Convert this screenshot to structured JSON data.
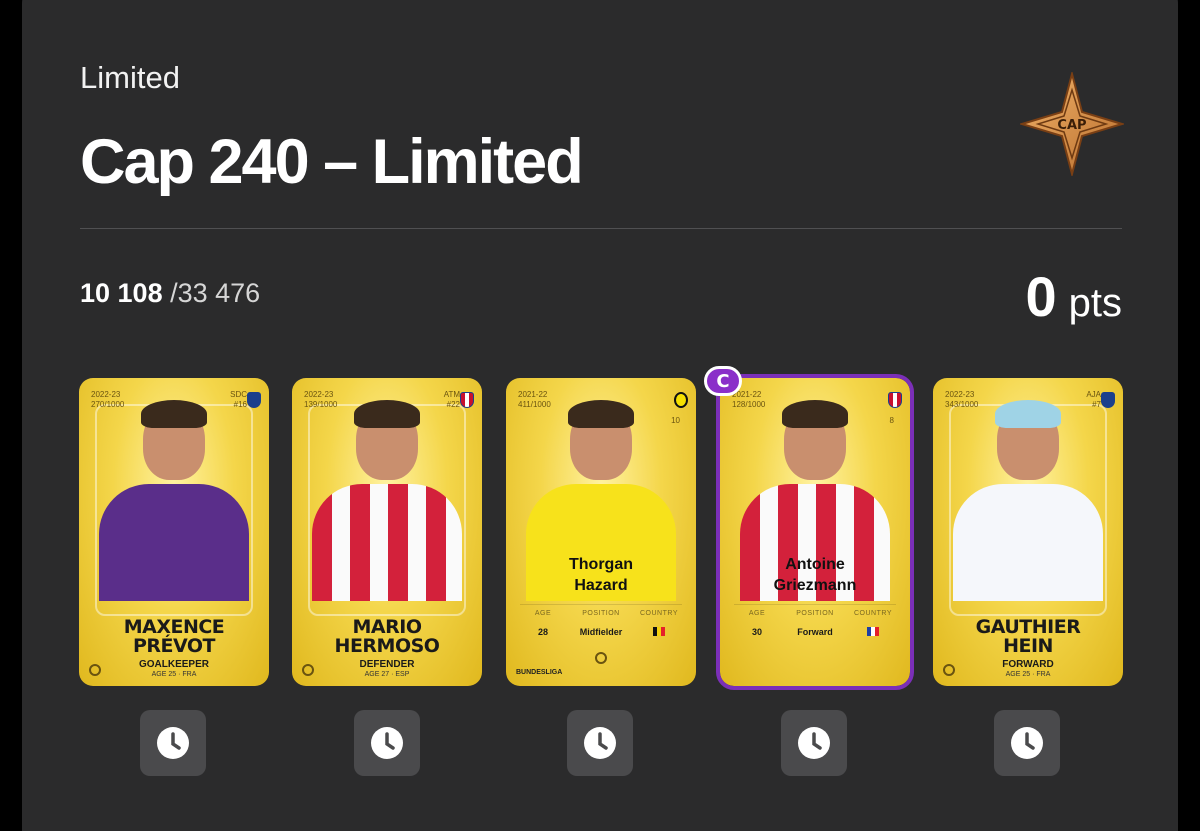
{
  "header": {
    "league_label": "Limited",
    "competition_title": "Cap 240 – Limited",
    "badge_text": "CAP"
  },
  "ranking": {
    "position": "10 108",
    "total": "/33 476"
  },
  "score": {
    "value": "0",
    "unit": "pts"
  },
  "cards": [
    {
      "season": "2022-23",
      "serial": "270/1000",
      "club_code": "SDC",
      "shirt_number": "#16",
      "name_line1": "MAXENCE",
      "name_line2": "PRÉVOT",
      "position": "GOALKEEPER",
      "age_country": "AGE 25 · FRA",
      "kit": "purple",
      "captain": false
    },
    {
      "season": "2022-23",
      "serial": "139/1000",
      "club_code": "ATM",
      "shirt_number": "#22",
      "name_line1": "MARIO",
      "name_line2": "HERMOSO",
      "position": "DEFENDER",
      "age_country": "AGE 27 · ESP",
      "kit": "atm",
      "captain": false
    },
    {
      "season": "2021-22",
      "serial": "411/1000",
      "number": "10",
      "name_line1": "Thorgan",
      "name_line2": "Hazard",
      "stat_labels": [
        "AGE",
        "POSITION",
        "COUNTRY"
      ],
      "age": "28",
      "position": "Midfielder",
      "league": "BUNDESLIGA",
      "kit": "bvb",
      "captain": false
    },
    {
      "season": "2021-22",
      "serial": "128/1000",
      "number": "8",
      "name_line1": "Antoine",
      "name_line2": "Griezmann",
      "stat_labels": [
        "AGE",
        "POSITION",
        "COUNTRY"
      ],
      "age": "30",
      "position": "Forward",
      "kit": "atm",
      "captain": true
    },
    {
      "season": "2022-23",
      "serial": "343/1000",
      "club_code": "AJA",
      "shirt_number": "#7",
      "name_line1": "GAUTHIER",
      "name_line2": "HEIN",
      "position": "FORWARD",
      "age_country": "AGE 25 · FRA",
      "kit": "aja",
      "captain": false
    }
  ],
  "captain_badge": "C",
  "colors": {
    "panel": "#2b2b2c",
    "card_gold": "#f4d64a",
    "captain_purple": "#8a2fc9",
    "timer_bg": "#4a4a4c"
  }
}
